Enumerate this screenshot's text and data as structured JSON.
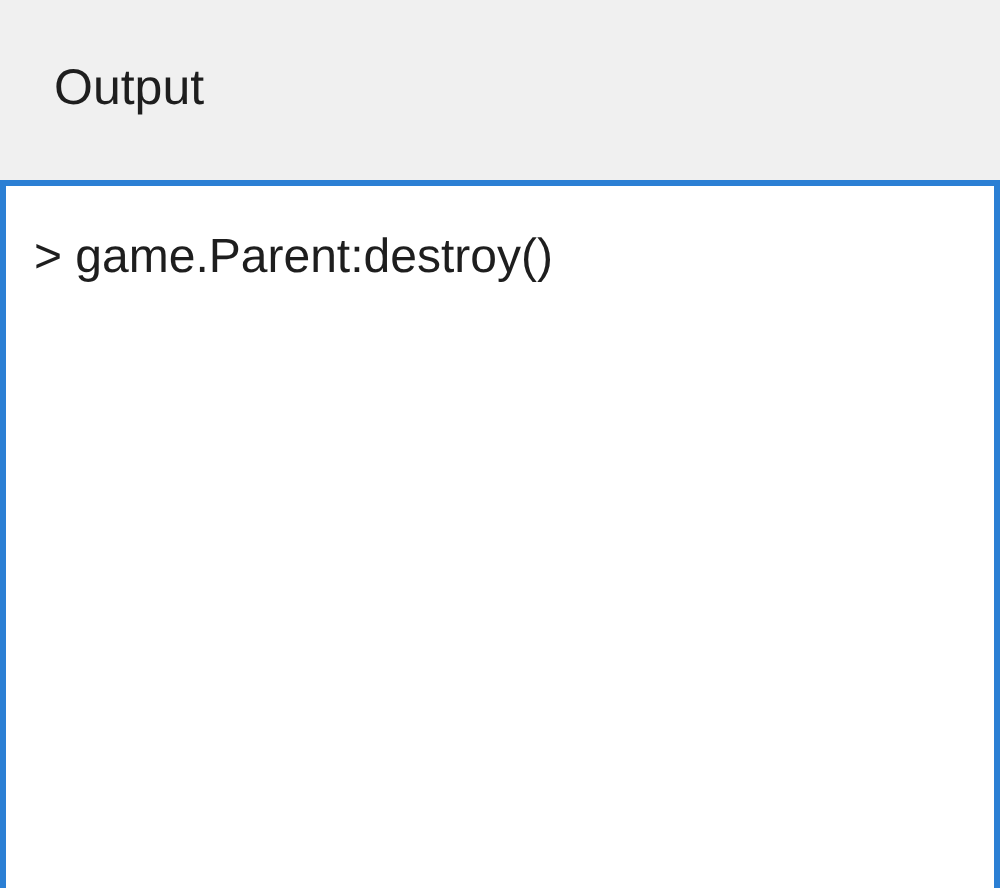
{
  "panel": {
    "title": "Output"
  },
  "output": {
    "lines": [
      "> game.Parent:destroy()"
    ]
  }
}
